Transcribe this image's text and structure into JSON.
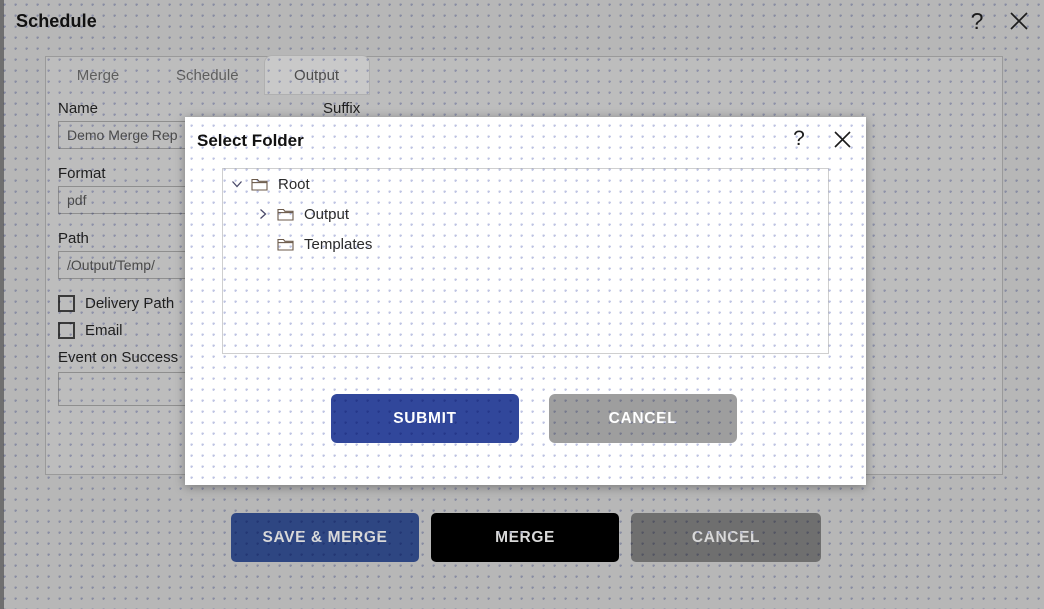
{
  "window": {
    "title": "Schedule",
    "help_icon": "help-icon",
    "close_icon": "close-icon",
    "help_glyph": "?"
  },
  "tabs": [
    {
      "label": "Merge",
      "active": false
    },
    {
      "label": "Schedule",
      "active": false
    },
    {
      "label": "Output",
      "active": true
    }
  ],
  "form": {
    "name_label": "Name",
    "name_value": "Demo Merge Rep",
    "suffix_label": "Suffix",
    "format_label": "Format",
    "format_value": "pdf",
    "path_label": "Path",
    "path_value": "/Output/Temp/",
    "delivery_path_label": "Delivery Path",
    "email_label": "Email",
    "event_on_success_label": "Event on Success",
    "event_on_success_value": ""
  },
  "footer_buttons": [
    {
      "label": "SAVE & MERGE",
      "style": "primary"
    },
    {
      "label": "MERGE",
      "style": "dark"
    },
    {
      "label": "CANCEL",
      "style": "muted"
    }
  ],
  "modal": {
    "title": "Select Folder",
    "help_glyph": "?",
    "help_icon": "help-icon",
    "close_icon": "close-icon",
    "tree": [
      {
        "label": "Root",
        "depth": 0,
        "twist": "expanded",
        "icon": "folder-icon"
      },
      {
        "label": "Output",
        "depth": 1,
        "twist": "collapsed",
        "icon": "folder-icon"
      },
      {
        "label": "Templates",
        "depth": 1,
        "twist": "none",
        "icon": "folder-icon"
      }
    ],
    "submit_label": "SUBMIT",
    "cancel_label": "CANCEL"
  },
  "colors": {
    "page_bg": "#b7b7b7",
    "card_bg": "#bdbdbd",
    "tab_active_bg": "#c9c9c9",
    "modal_bg": "#ffffff",
    "submit_blue": "#31479b",
    "cancel_gray": "#9e9e9e",
    "save_merge_blue": "#2e4682",
    "merge_black": "#000000",
    "footer_cancel_gray": "#6f6f6f",
    "stipple_dot": "#606eb9"
  }
}
